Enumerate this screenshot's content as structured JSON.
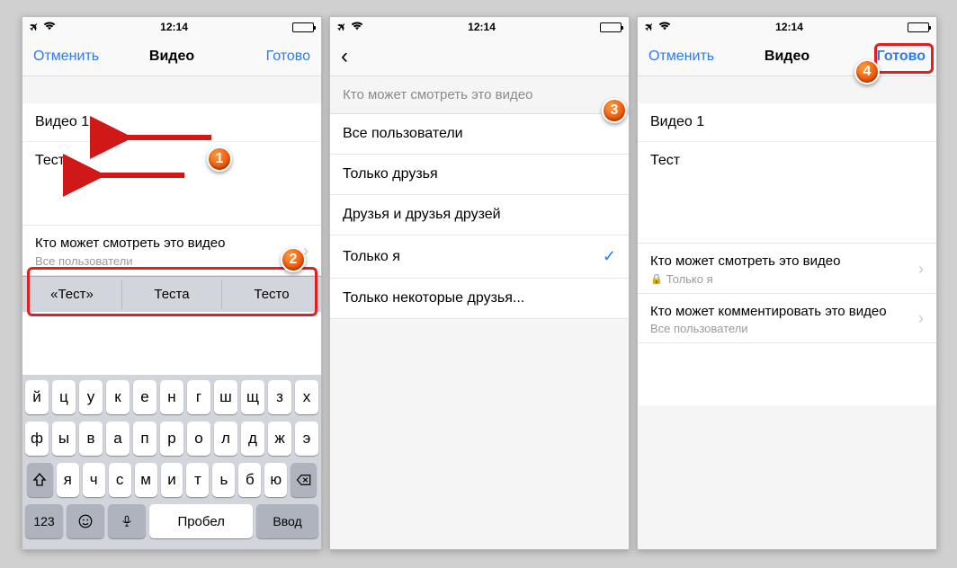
{
  "status": {
    "time": "12:14"
  },
  "screen1": {
    "nav": {
      "cancel": "Отменить",
      "title": "Видео",
      "done": "Готово"
    },
    "title_value": "Видео 1",
    "desc_value": "Тест",
    "privacy_label": "Кто может смотреть это видео",
    "privacy_value": "Все пользователи",
    "suggestions": [
      "«Тест»",
      "Теста",
      "Тесто"
    ],
    "rows": {
      "r1": [
        "й",
        "ц",
        "у",
        "к",
        "е",
        "н",
        "г",
        "ш",
        "щ",
        "з",
        "х"
      ],
      "r2": [
        "ф",
        "ы",
        "в",
        "а",
        "п",
        "р",
        "о",
        "л",
        "д",
        "ж",
        "э"
      ],
      "r3": [
        "я",
        "ч",
        "с",
        "м",
        "и",
        "т",
        "ь",
        "б",
        "ю"
      ]
    },
    "keys": {
      "num": "123",
      "space": "Пробел",
      "enter": "Ввод"
    }
  },
  "screen2": {
    "header": "Кто может смотреть это видео",
    "options": [
      {
        "label": "Все пользователи",
        "checked": false
      },
      {
        "label": "Только друзья",
        "checked": false
      },
      {
        "label": "Друзья и друзья друзей",
        "checked": false
      },
      {
        "label": "Только я",
        "checked": true
      },
      {
        "label": "Только некоторые друзья...",
        "checked": false
      }
    ]
  },
  "screen3": {
    "nav": {
      "cancel": "Отменить",
      "title": "Видео",
      "done": "Готово"
    },
    "title_value": "Видео 1",
    "desc_value": "Тест",
    "privacy_view": {
      "label": "Кто может смотреть это видео",
      "value": "Только я"
    },
    "privacy_comment": {
      "label": "Кто может комментировать это видео",
      "value": "Все пользователи"
    }
  },
  "callouts": {
    "c1": "1",
    "c2": "2",
    "c3": "3",
    "c4": "4"
  }
}
